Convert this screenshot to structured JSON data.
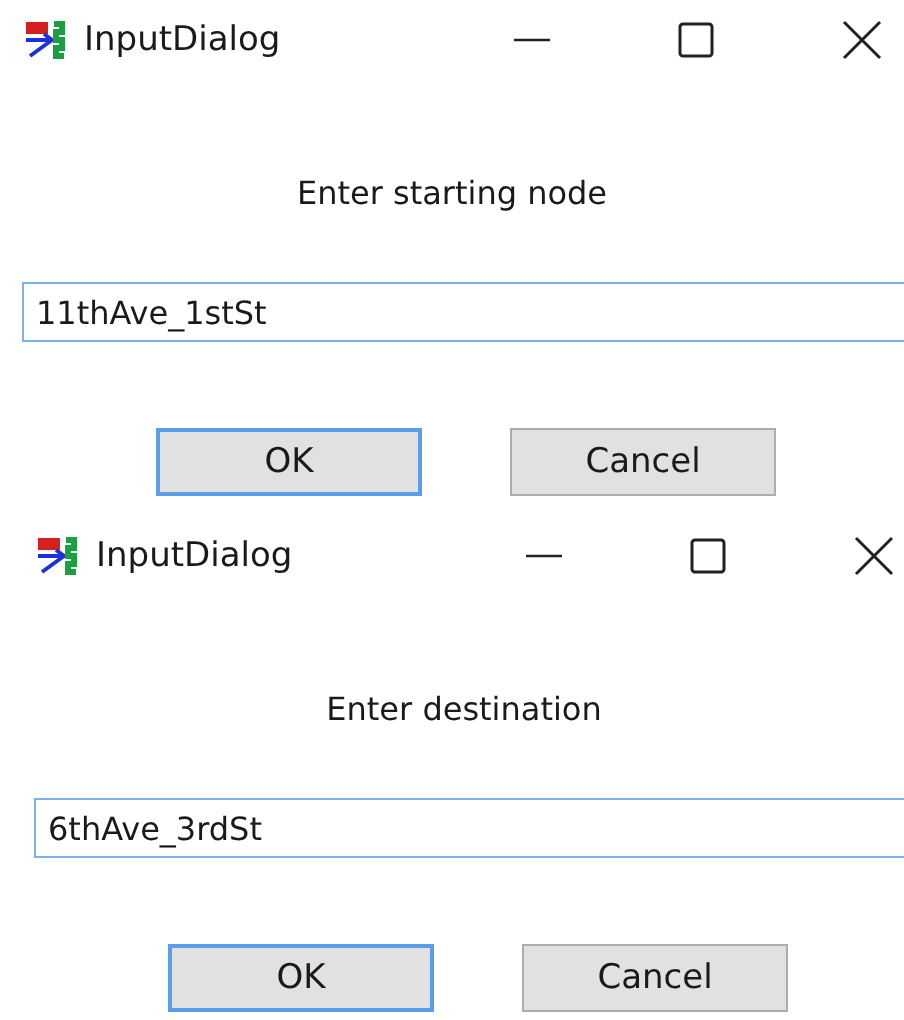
{
  "dialogs": [
    {
      "window": {
        "title": "InputDialog"
      },
      "prompt": "Enter starting node",
      "input": {
        "value": "11thAve_1stSt"
      },
      "buttons": [
        {
          "label": "OK",
          "default": true
        },
        {
          "label": "Cancel",
          "default": false
        }
      ]
    },
    {
      "window": {
        "title": "InputDialog"
      },
      "prompt": "Enter destination",
      "input": {
        "value": "6thAve_3rdSt"
      },
      "buttons": [
        {
          "label": "OK",
          "default": true
        },
        {
          "label": "Cancel",
          "default": false
        }
      ]
    }
  ]
}
